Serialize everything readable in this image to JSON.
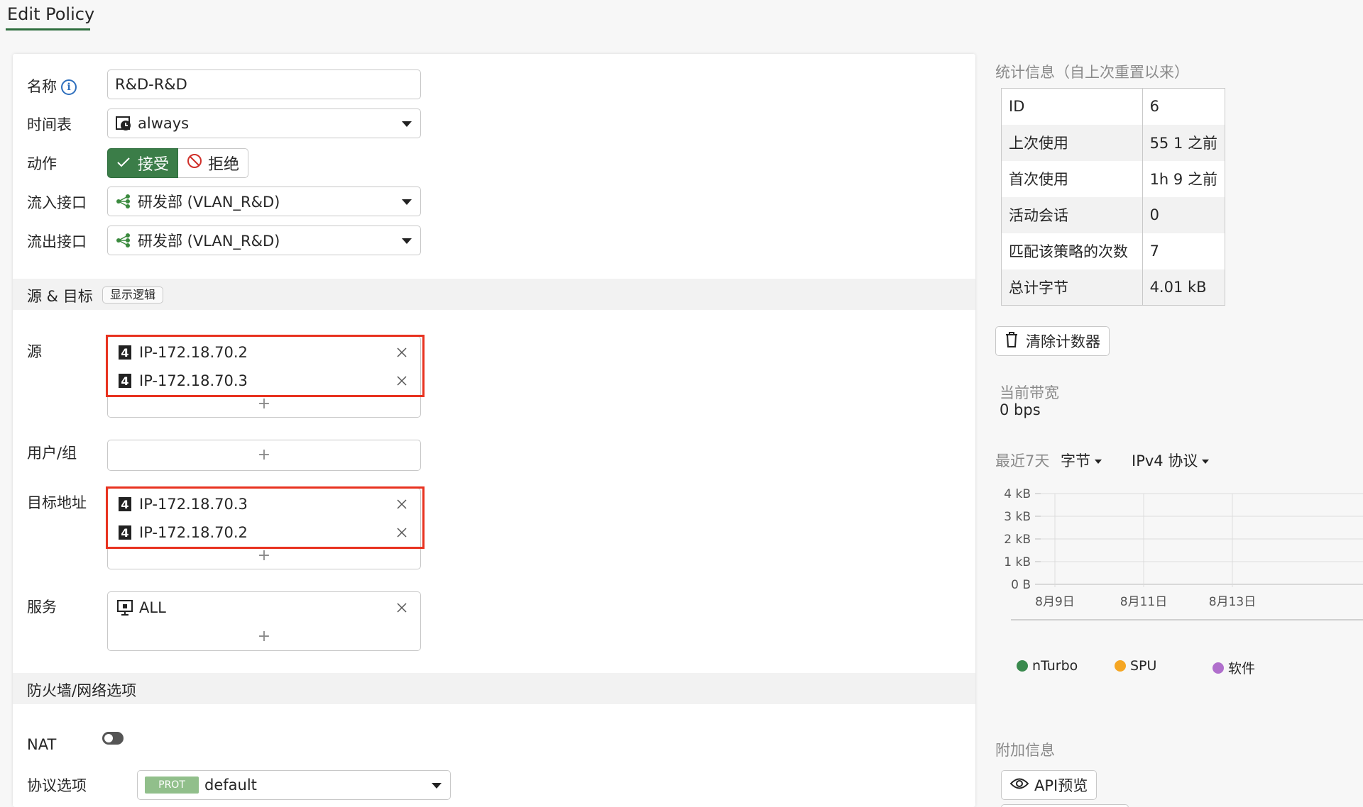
{
  "header": {
    "title": "Edit Policy"
  },
  "form": {
    "name_label": "名称",
    "name_value": "R&D-R&D",
    "schedule_label": "时间表",
    "schedule_value": "always",
    "action_label": "动作",
    "action_accept": "接受",
    "action_deny": "拒绝",
    "in_iface_label": "流入接口",
    "in_iface_value": "研发部 (VLAN_R&D)",
    "out_iface_label": "流出接口",
    "out_iface_value": "研发部 (VLAN_R&D)",
    "section_src_dst": "源 & 目标",
    "show_logic": "显示逻辑",
    "source_label": "源",
    "source_items": [
      "IP-172.18.70.2",
      "IP-172.18.70.3"
    ],
    "user_group_label": "用户/组",
    "dest_label": "目标地址",
    "dest_items": [
      "IP-172.18.70.3",
      "IP-172.18.70.2"
    ],
    "service_label": "服务",
    "service_items": [
      "ALL"
    ],
    "add_symbol": "+",
    "section_firewall": "防火墙/网络选项",
    "nat_label": "NAT",
    "protocol_label": "协议选项",
    "protocol_badge": "PROT",
    "protocol_value": "default"
  },
  "sidebar": {
    "stats_heading": "统计信息（自上次重置以来）",
    "stats": [
      {
        "key": "ID",
        "value": "6"
      },
      {
        "key": "上次使用",
        "value": "55 1 之前"
      },
      {
        "key": "首次使用",
        "value": "1h 9 之前"
      },
      {
        "key": "活动会话",
        "value": "0"
      },
      {
        "key": "匹配该策略的次数",
        "value": "7"
      },
      {
        "key": "总计字节",
        "value": "4.01 kB"
      }
    ],
    "clear_counters": "清除计数器",
    "bandwidth_heading": "当前带宽",
    "bandwidth_value": "0 bps",
    "period_label": "最近7天",
    "metric_dropdown": "字节",
    "protocol_dropdown": "IPv4 协议",
    "extra_heading": "附加信息",
    "api_preview": "API预览"
  },
  "chart_data": {
    "type": "line",
    "categories": [
      "8月9日",
      "8月11日",
      "8月13日"
    ],
    "y_ticks": [
      "0 B",
      "1 kB",
      "2 kB",
      "3 kB",
      "4 kB"
    ],
    "ylim": [
      0,
      4
    ],
    "grid": true,
    "legend_position": "bottom",
    "series": [
      {
        "name": "nTurbo",
        "color": "#3a8a4e",
        "values": []
      },
      {
        "name": "SPU",
        "color": "#f5a623",
        "values": []
      },
      {
        "name": "软件",
        "color": "#b06fcc",
        "values": []
      }
    ]
  },
  "colors": {
    "accent_green": "#3b7d48",
    "highlight_red": "#e8321f",
    "link_blue": "#2e6fbd"
  }
}
